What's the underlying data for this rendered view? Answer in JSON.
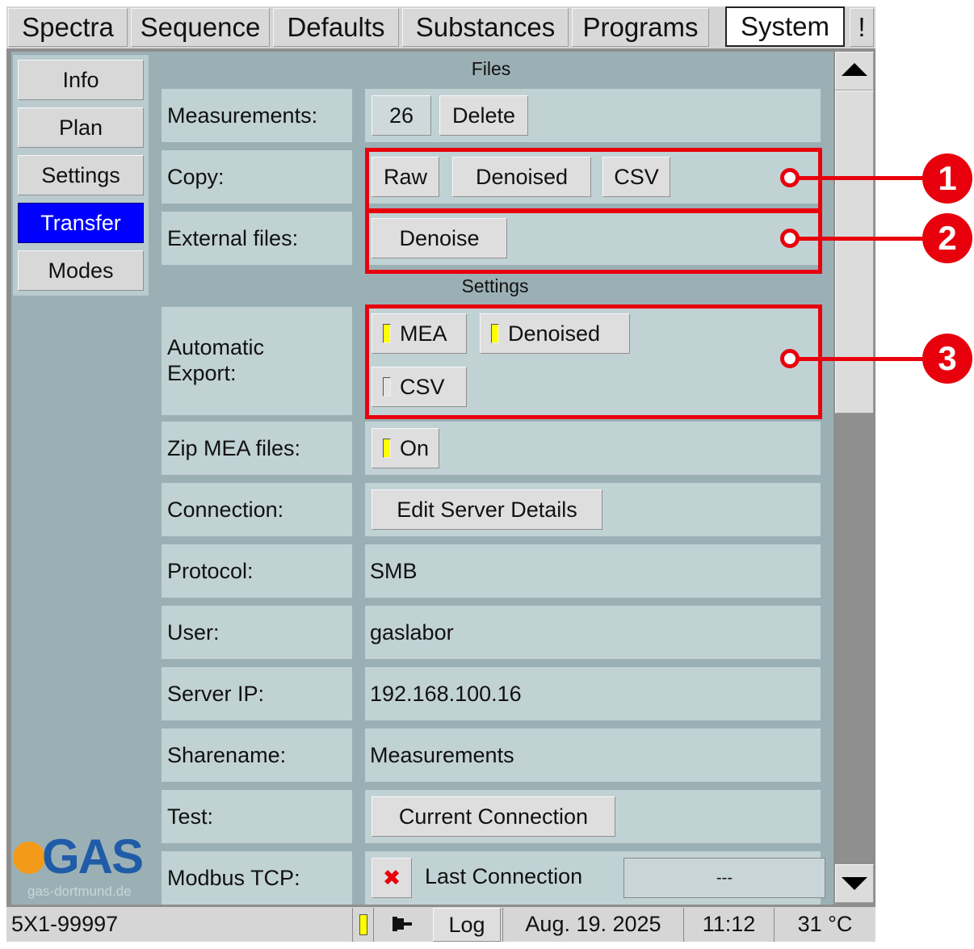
{
  "tabs": [
    {
      "label": "Spectra",
      "active": false
    },
    {
      "label": "Sequence",
      "active": false
    },
    {
      "label": "Defaults",
      "active": false
    },
    {
      "label": "Substances",
      "active": false
    },
    {
      "label": "Programs",
      "active": false
    },
    {
      "label": "System",
      "active": true
    },
    {
      "label": "!",
      "active": false
    }
  ],
  "nav": [
    {
      "label": "Info",
      "active": false
    },
    {
      "label": "Plan",
      "active": false
    },
    {
      "label": "Settings",
      "active": false
    },
    {
      "label": "Transfer",
      "active": true
    },
    {
      "label": "Modes",
      "active": false
    }
  ],
  "files": {
    "title": "Files",
    "measurements_label": "Measurements:",
    "measurements_count": "26",
    "delete_label": "Delete",
    "copy_label": "Copy:",
    "copy_raw": "Raw",
    "copy_denoised": "Denoised",
    "copy_csv": "CSV",
    "external_label": "External files:",
    "denoise_label": "Denoise"
  },
  "settings": {
    "title": "Settings",
    "auto_export_label_1": "Automatic",
    "auto_export_label_2": "Export:",
    "export_mea": {
      "label": "MEA",
      "checked": true
    },
    "export_denoised": {
      "label": "Denoised",
      "checked": true
    },
    "export_csv": {
      "label": "CSV",
      "checked": false
    },
    "zip_label": "Zip MEA files:",
    "zip_on": {
      "label": "On",
      "checked": true
    },
    "connection_label": "Connection:",
    "edit_server_label": "Edit Server Details",
    "protocol_label": "Protocol:",
    "protocol_value": "SMB",
    "user_label": "User:",
    "user_value": "gaslabor",
    "server_ip_label": "Server IP:",
    "server_ip_value": "192.168.100.16",
    "sharename_label": "Sharename:",
    "sharename_value": "Measurements",
    "test_label": "Test:",
    "current_connection_label": "Current Connection",
    "modbus_label": "Modbus TCP:",
    "last_connection_label": "Last Connection",
    "last_connection_value": "---"
  },
  "logo": {
    "text": "GAS",
    "sub": "gas-dortmund.de"
  },
  "status": {
    "device_id": "5X1-99997",
    "log_label": "Log",
    "date": "Aug. 19. 2025",
    "time": "11:12",
    "temperature": "31 °C"
  },
  "callouts": [
    "1",
    "2",
    "3"
  ],
  "colors": {
    "accent_active": "#0000ff",
    "callout": "#e8000c",
    "indicator_on": "#ffff00",
    "panel": "#9bb0b5",
    "cell": "#c1d2d5"
  }
}
